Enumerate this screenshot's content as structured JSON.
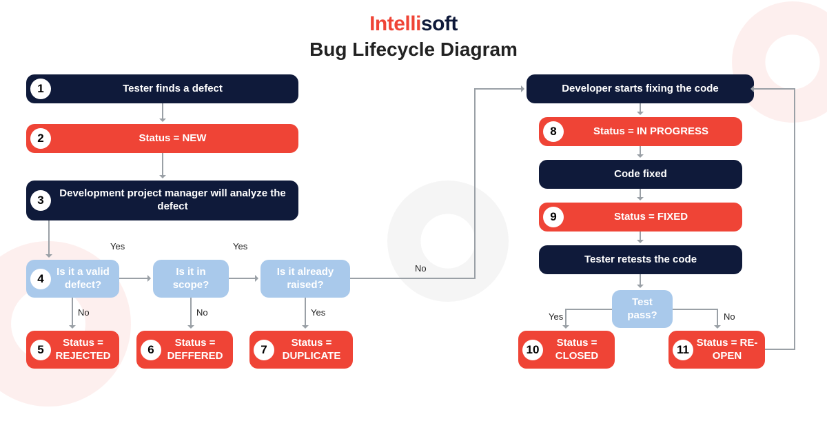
{
  "logo": {
    "part1": "Intelli",
    "part2": "soft"
  },
  "title": "Bug Lifecycle Diagram",
  "nodes": {
    "n1": {
      "num": "1",
      "text": "Tester finds a defect"
    },
    "n2": {
      "num": "2",
      "text": "Status = NEW"
    },
    "n3": {
      "num": "3",
      "text": "Development project manager will analyze the defect"
    },
    "n4": {
      "num": "4",
      "text": "Is it a valid defect?"
    },
    "n5": {
      "num": "5",
      "text": "Status = REJECTED"
    },
    "n6": {
      "num": "6",
      "text": "Status = DEFFERED"
    },
    "n7": {
      "num": "7",
      "text": "Status = DUPLICATE"
    },
    "nScope": {
      "text": "Is it in scope?"
    },
    "nRaised": {
      "text": "Is it already raised?"
    },
    "nDevStart": {
      "text": "Developer starts fixing the code"
    },
    "n8": {
      "num": "8",
      "text": "Status = IN PROGRESS"
    },
    "nFixed": {
      "text": "Code fixed"
    },
    "n9": {
      "num": "9",
      "text": "Status = FIXED"
    },
    "nRetest": {
      "text": "Tester retests the code"
    },
    "nTestPass": {
      "text": "Test pass?"
    },
    "n10": {
      "num": "10",
      "text": "Status = CLOSED"
    },
    "n11": {
      "num": "11",
      "text": "Status = RE-OPEN"
    }
  },
  "labels": {
    "yes": "Yes",
    "no": "No"
  }
}
